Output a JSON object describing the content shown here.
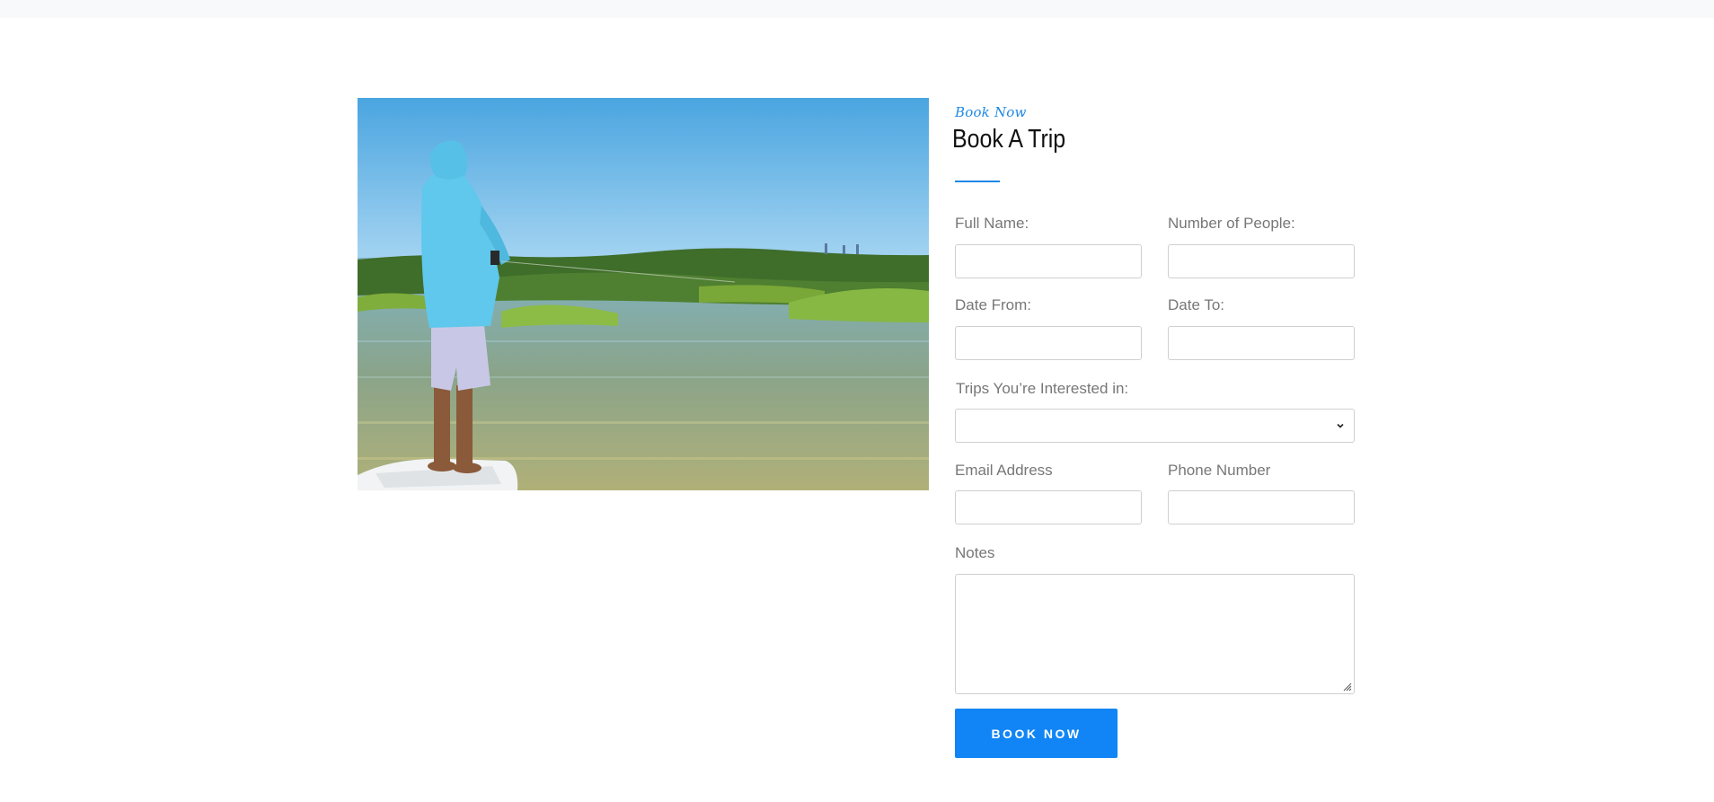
{
  "section": {
    "eyebrow": "Book Now",
    "title": "Book A Trip",
    "accent_color": "#1e88e5"
  },
  "photo": {
    "subject": "angler in a light-blue hooded shirt fishing from a boat bow over shallow marsh water"
  },
  "form": {
    "full_name": {
      "label": "Full Name:",
      "value": ""
    },
    "number_of_people": {
      "label": "Number of People:",
      "value": ""
    },
    "date_from": {
      "label": "Date From:",
      "value": ""
    },
    "date_to": {
      "label": "Date To:",
      "value": ""
    },
    "trips": {
      "label": "Trips You’re Interested in:",
      "selected": ""
    },
    "email": {
      "label": "Email Address",
      "value": ""
    },
    "phone": {
      "label": "Phone Number",
      "value": ""
    },
    "notes": {
      "label": "Notes",
      "value": ""
    },
    "submit_label": "BOOK NOW",
    "submit_color": "#1185f5"
  }
}
